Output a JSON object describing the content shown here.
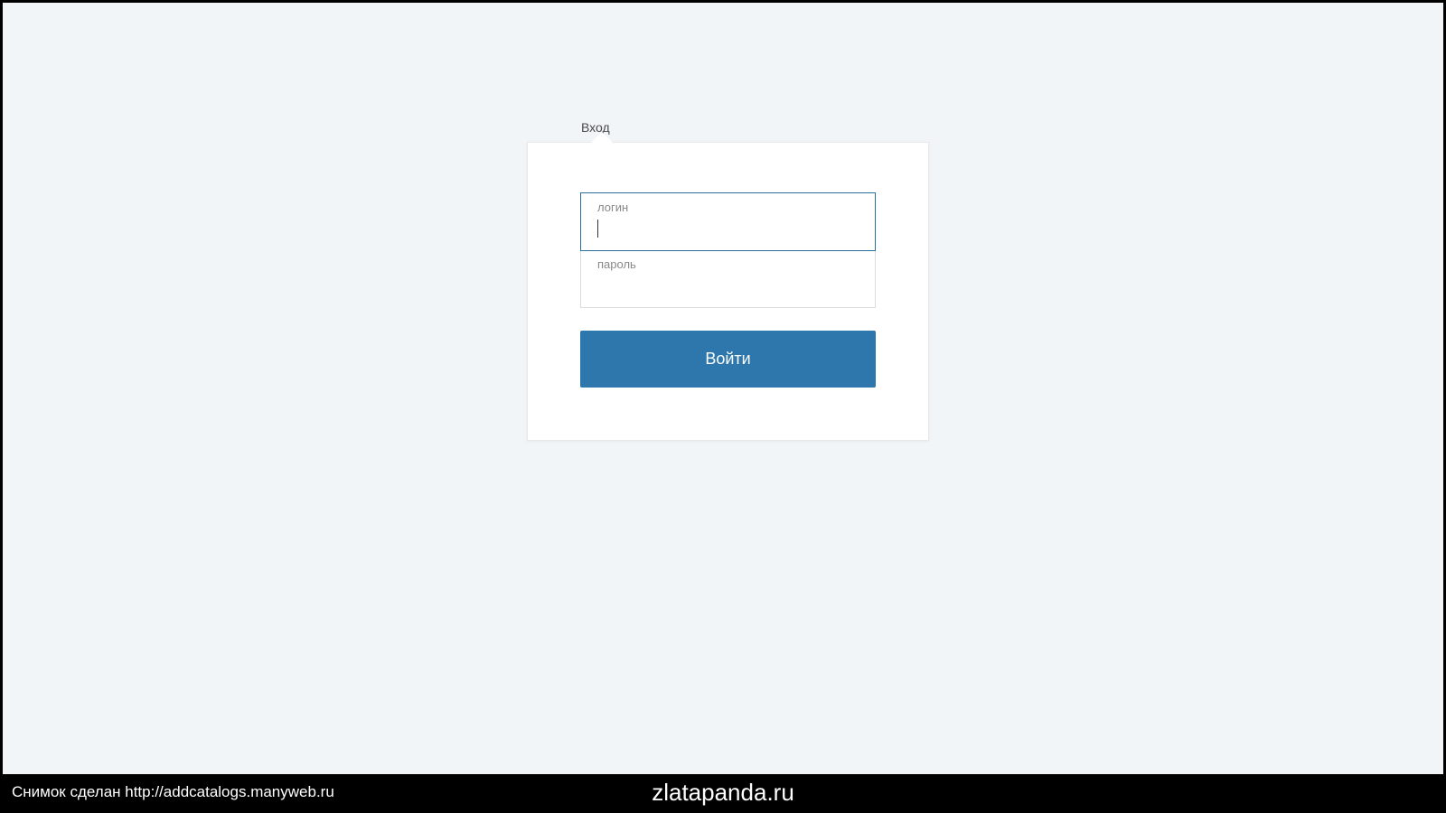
{
  "login": {
    "title": "Вход",
    "username_label": "логин",
    "password_label": "пароль",
    "button_label": "Войти"
  },
  "footer": {
    "left_text": "Снимок сделан http://addcatalogs.manyweb.ru",
    "center_text": "zlatapanda.ru"
  }
}
